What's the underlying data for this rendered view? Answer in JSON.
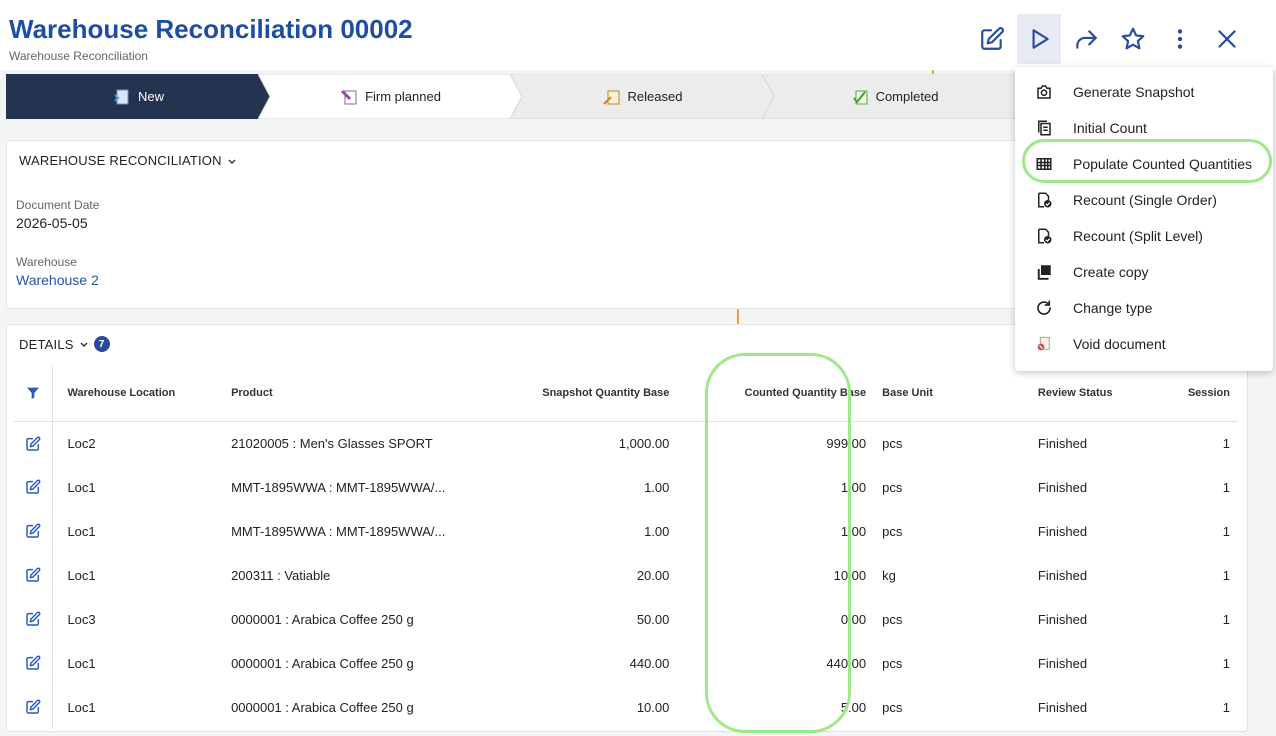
{
  "header": {
    "title": "Warehouse Reconciliation 00002",
    "subtitle": "Warehouse Reconciliation"
  },
  "toolbar": {
    "edit_icon": "edit-icon",
    "process_icon": "play-icon",
    "share_icon": "share-icon",
    "favorite_icon": "star-icon",
    "more_icon": "more-vertical-icon",
    "close_icon": "close-icon"
  },
  "stepper": {
    "steps": [
      {
        "label": "New",
        "icon": "new-doc-icon",
        "active": true
      },
      {
        "label": "Firm planned",
        "icon": "firm-planned-icon",
        "active": false
      },
      {
        "label": "Released",
        "icon": "released-icon",
        "active": false
      },
      {
        "label": "Completed",
        "icon": "completed-icon",
        "active": false
      }
    ]
  },
  "main_section": {
    "title": "WAREHOUSE RECONCILIATION",
    "document_date_label": "Document Date",
    "document_date": "2026-05-05",
    "warehouse_label": "Warehouse",
    "warehouse": "Warehouse 2"
  },
  "details": {
    "title": "DETAILS",
    "count": "7",
    "columns": [
      "Warehouse Location",
      "Product",
      "Snapshot Quantity Base",
      "Counted Quantity Base",
      "Base Unit",
      "Review Status",
      "Session"
    ],
    "rows": [
      [
        "Loc2",
        "21020005 : Men's Glasses SPORT",
        "1,000.00",
        "999.00",
        "pcs",
        "Finished",
        "1"
      ],
      [
        "Loc1",
        "MMT-1895WWA : MMT-1895WWA/...",
        "1.00",
        "1.00",
        "pcs",
        "Finished",
        "1"
      ],
      [
        "Loc1",
        "MMT-1895WWA : MMT-1895WWA/...",
        "1.00",
        "1.00",
        "pcs",
        "Finished",
        "1"
      ],
      [
        "Loc1",
        "200311 : Vatiable",
        "20.00",
        "10.00",
        "kg",
        "Finished",
        "1"
      ],
      [
        "Loc3",
        "0000001 : Arabica Coffee 250 g",
        "50.00",
        "0.00",
        "pcs",
        "Finished",
        "1"
      ],
      [
        "Loc1",
        "0000001 : Arabica Coffee 250 g",
        "440.00",
        "440.00",
        "pcs",
        "Finished",
        "1"
      ],
      [
        "Loc1",
        "0000001 : Arabica Coffee 250 g",
        "10.00",
        "5.00",
        "pcs",
        "Finished",
        "1"
      ]
    ]
  },
  "menu": {
    "items": [
      {
        "label": "Generate Snapshot",
        "icon": "camera-icon"
      },
      {
        "label": "Initial Count",
        "icon": "copy-doc-icon"
      },
      {
        "label": "Populate Counted Quantities",
        "icon": "grid-icon"
      },
      {
        "label": "Recount (Single Order)",
        "icon": "doc-check-icon"
      },
      {
        "label": "Recount (Split Level)",
        "icon": "doc-check-icon"
      },
      {
        "label": "Create copy",
        "icon": "copy-icon"
      },
      {
        "label": "Change type",
        "icon": "refresh-icon"
      },
      {
        "label": "Void document",
        "icon": "void-doc-icon"
      }
    ]
  },
  "colors": {
    "title": "#1f4e9e",
    "active_step": "#24334f",
    "link": "#2454a8",
    "highlight": "#9ee88a",
    "badge": "#2a4b9b"
  }
}
